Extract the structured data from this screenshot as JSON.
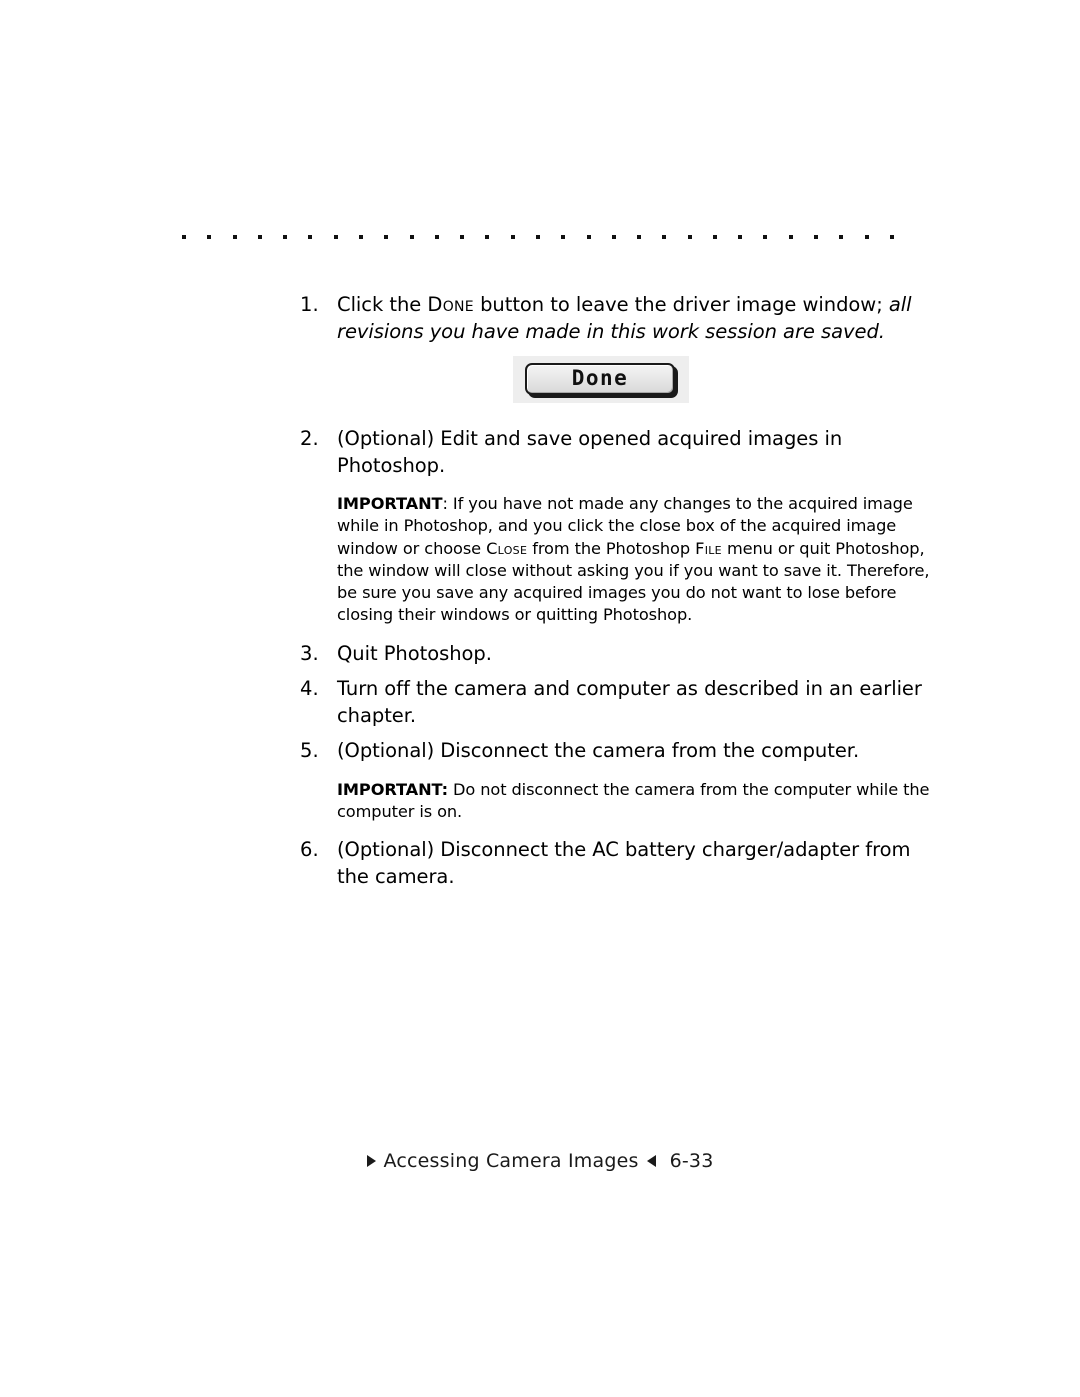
{
  "document": {
    "type": "manual-page",
    "rule": {
      "dot_count": 29,
      "dot_color": "#111111"
    },
    "steps": [
      {
        "number": "1.",
        "text_before_smallcaps": "Click the ",
        "smallcaps": "Done",
        "text_after_smallcaps": " button to leave the driver image window; ",
        "italic_tail": "all revisions you have made in this work session are saved."
      },
      {
        "number": "2.",
        "text": "(Optional) Edit and save opened acquired images in Photoshop."
      },
      {
        "number": "3.",
        "text": "Quit Photoshop."
      },
      {
        "number": "4.",
        "text": "Turn off the camera and computer as described in an earlier chapter."
      },
      {
        "number": "5.",
        "text": "(Optional) Disconnect the camera from the computer."
      },
      {
        "number": "6.",
        "text": "(Optional) Disconnect the AC battery charger/adapter from the camera."
      }
    ],
    "notes": {
      "note_1": {
        "label": "IMPORTANT",
        "part_1": ": If you have not made any changes to the acquired image while in Photoshop, and you click the close box of the acquired image window or choose ",
        "smallcaps_1": "Close",
        "part_2": " from the Photoshop ",
        "smallcaps_2": "File",
        "part_3": " menu or quit Photoshop, the window will close without asking you if you want to save it. Therefore, be sure you save any acquired images you do not want to lose before closing their windows or quitting Photoshop."
      },
      "note_2": {
        "label": "IMPORTANT:",
        "text": " Do not disconnect the camera from the computer while the computer is on."
      }
    },
    "button_figure": {
      "label": "Done",
      "style": "classic-mac-default-button",
      "background": "#eeeeee",
      "border_color": "#1a1a1a"
    },
    "footer": {
      "left_marker": "right-triangle",
      "title": "Accessing Camera Images",
      "right_marker": "left-triangle",
      "page_number": "6-33"
    }
  }
}
